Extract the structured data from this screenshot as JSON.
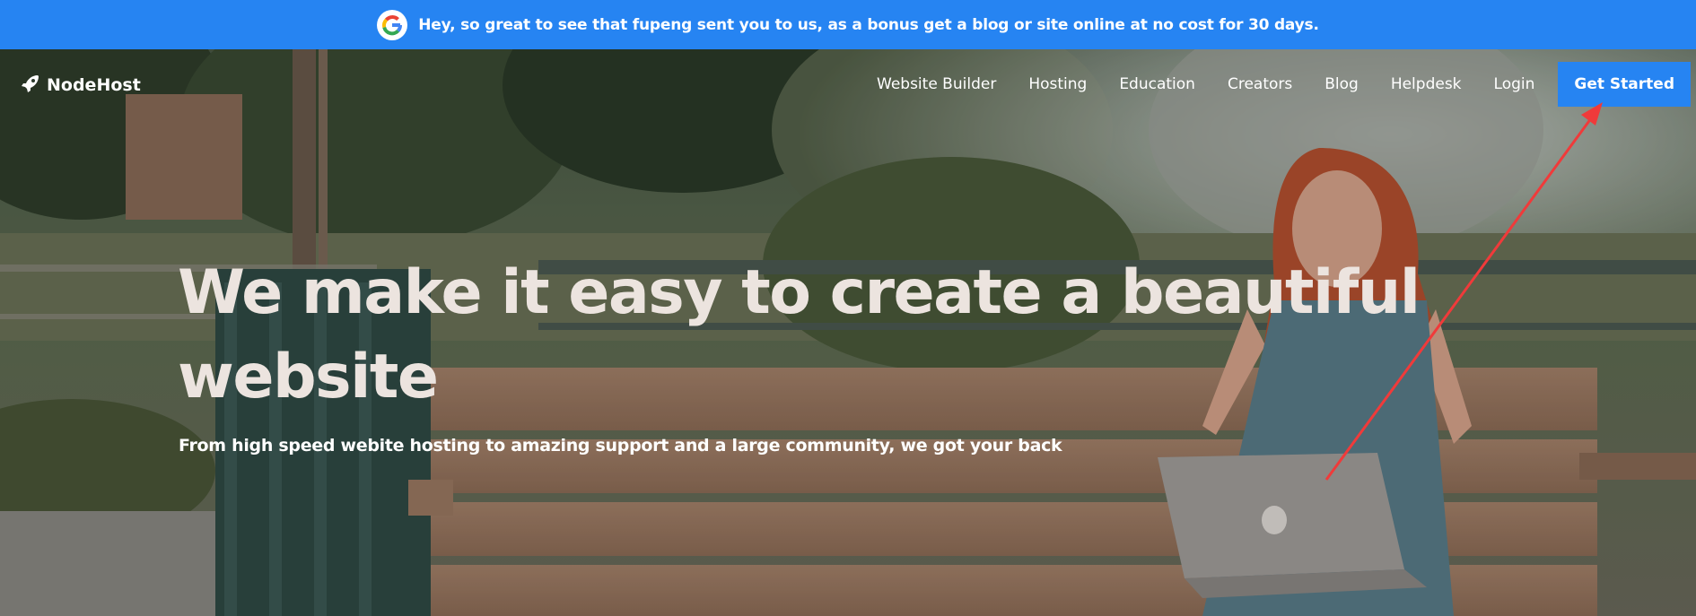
{
  "banner": {
    "icon": "google-g-logo",
    "text": "Hey, so great to see that fupeng sent you to us, as a bonus get a blog or site online at no cost for 30 days."
  },
  "nav": {
    "brand": "NodeHost",
    "brand_icon": "rocket-icon",
    "links": [
      "Website Builder",
      "Hosting",
      "Education",
      "Creators",
      "Blog",
      "Helpdesk",
      "Login"
    ],
    "cta": "Get Started"
  },
  "hero": {
    "headline": "We make it easy to create a beautiful website",
    "subline": "From high speed webite hosting to amazing support and a large community, we got your back"
  },
  "colors": {
    "accent": "#2684f2",
    "annotation": "#f03a3a"
  }
}
